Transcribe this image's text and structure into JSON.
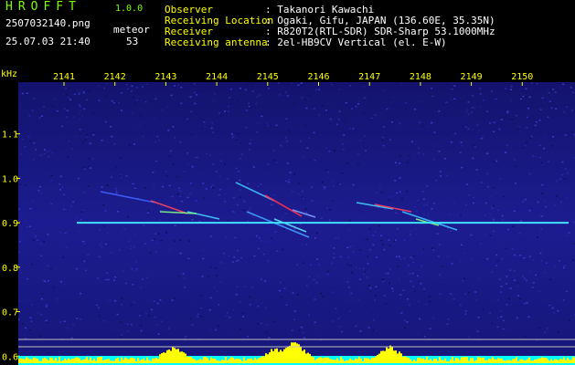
{
  "header": {
    "logo": "HROFFT",
    "version": "1.0.0",
    "filename": "2507032140.png",
    "datetime": "25.07.03 21:40",
    "meteor_label": "meteor",
    "meteor_count": "53",
    "fields": [
      {
        "label": "Observer",
        "value": ": Takanori Kawachi"
      },
      {
        "label": "Receiving Location",
        "value": ": Ogaki, Gifu, JAPAN (136.60E, 35.35N)"
      },
      {
        "label": "Receiver",
        "value": ": R820T2(RTL-SDR) SDR-Sharp 53.1000MHz"
      },
      {
        "label": "Receiving antenna",
        "value": ": 2el-HB9CV Vertical (el. E-W)"
      }
    ]
  },
  "chart_data": {
    "type": "heatmap",
    "unit_label": "kHz",
    "x_ticks": [
      "2141",
      "2142",
      "2143",
      "2144",
      "2145",
      "2146",
      "2147",
      "2148",
      "2149",
      "2150"
    ],
    "y_ticks": [
      "1.1",
      "1.0",
      "0.9",
      "0.8",
      "0.7",
      "0.6"
    ],
    "ylim": [
      0.58,
      1.2
    ],
    "carrier_khz": 0.9,
    "colors": {
      "background": "#1a1a8c",
      "axis_text": "#ffff00",
      "carrier": "#40e0ff",
      "level_bar": "#ffff00",
      "floor_bar": "#00ffff"
    }
  }
}
